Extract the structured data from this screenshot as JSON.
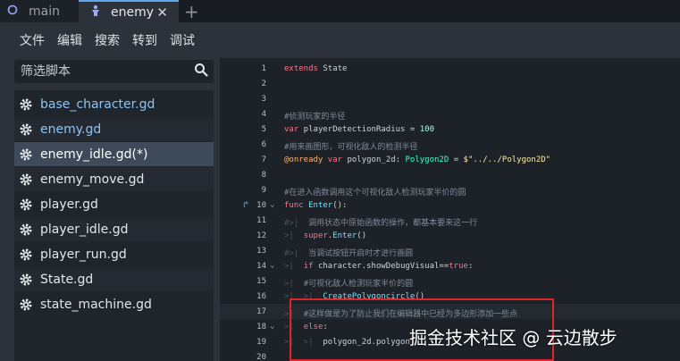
{
  "tabs": [
    {
      "label": "main",
      "icon": "circle-icon"
    },
    {
      "label": "enemy",
      "icon": "character-icon"
    }
  ],
  "menu": [
    "文件",
    "编辑",
    "搜索",
    "转到",
    "调试"
  ],
  "filter": {
    "placeholder": "筛选脚本"
  },
  "files": [
    {
      "name": "base_character.gd"
    },
    {
      "name": "enemy.gd"
    },
    {
      "name": "enemy_idle.gd(*)"
    },
    {
      "name": "enemy_move.gd"
    },
    {
      "name": "player.gd"
    },
    {
      "name": "player_idle.gd"
    },
    {
      "name": "player_run.gd"
    },
    {
      "name": "State.gd"
    },
    {
      "name": "state_machine.gd"
    }
  ],
  "code": {
    "line_numbers": [
      "1",
      "2",
      "3",
      "4",
      "5",
      "6",
      "7",
      "8",
      "9",
      "10",
      "11",
      "12",
      "13",
      "14",
      "15",
      "16",
      "17",
      "18",
      "19",
      "20"
    ],
    "l1_kw": "extends",
    "l1_rest": " State",
    "l4": "#侦测玩家的半径",
    "l5_kw": "var",
    "l5_rest": " playerDetectionRadius = ",
    "l5_num": "100",
    "l6": "#用来画图形，可视化敌人的检测半径",
    "l7_ann": "@onready",
    "l7_kw": " var",
    "l7_mid": " polygon_2d: ",
    "l7_type": "Polygon2D",
    "l7_eq": " = ",
    "l7_str": "$\"../../Polygon2D\"",
    "l9": "#在进入函数调用这个可视化敌人检测玩家半价的圆",
    "l10_kw": "func",
    "l10_fn": " Enter",
    "l10_rest": "():",
    "l11": "调用状态中原始函数的操作，都基本要来这一行",
    "l12_kw": "super",
    "l12_fn": ".Enter",
    "l12_rest": "()",
    "l13": "当调试按钮开启时才进行画圆",
    "l14_kw": "if",
    "l14_mid": " character.showDebugVisual==",
    "l14_kw2": "true",
    "l14_end": ":",
    "l15": "#可视化敌人检测玩家半价的圆",
    "l16_fn": "CreatePolygoncircle",
    "l16_rest": "()",
    "l17": "#这样做是为了防止我们在编辑器中已经为多边形添加一些点",
    "l18_kw": "else",
    "l18_rest": ":",
    "l19": "polygon_2d.polygon"
  },
  "watermark": "掘金技术社区 @ 云边散步"
}
